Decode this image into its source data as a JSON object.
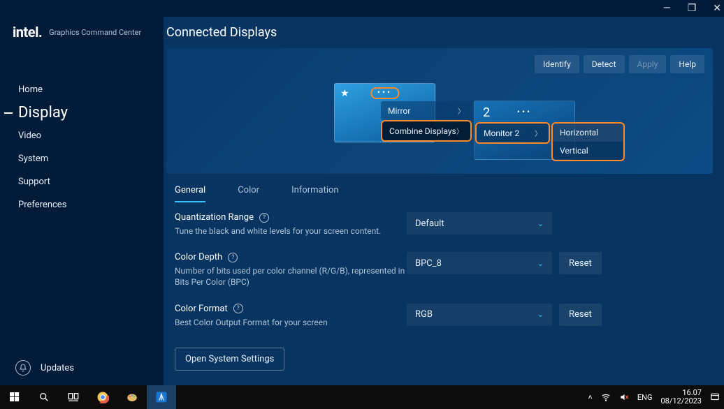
{
  "window": {
    "minimize": "—",
    "restore": "❐",
    "close": "✕"
  },
  "brand": {
    "logo": "intel.",
    "subtitle": "Graphics Command Center"
  },
  "sidebar": {
    "items": [
      {
        "label": "Home"
      },
      {
        "label": "Display"
      },
      {
        "label": "Video"
      },
      {
        "label": "System"
      },
      {
        "label": "Support"
      },
      {
        "label": "Preferences"
      }
    ],
    "updates": "Updates"
  },
  "page": {
    "title": "Connected Displays"
  },
  "actions": {
    "identify": "Identify",
    "detect": "Detect",
    "apply": "Apply",
    "help": "Help"
  },
  "monitors": {
    "mon1_star": "★",
    "mon1_dots": "•••",
    "mon2_num": "2",
    "mon2_dots": "•••"
  },
  "contextMenu": {
    "mirror": "Mirror",
    "combine": "Combine Displays",
    "monitor2": "Monitor 2",
    "horizontal": "Horizontal",
    "vertical": "Vertical"
  },
  "tabs": [
    {
      "label": "General"
    },
    {
      "label": "Color"
    },
    {
      "label": "Information"
    }
  ],
  "settings": {
    "quant": {
      "title": "Quantization Range",
      "desc": "Tune the black and white levels for your screen content.",
      "value": "Default"
    },
    "depth": {
      "title": "Color Depth",
      "desc": "Number of bits used per color channel (R/G/B), represented in Bits Per Color (BPC)",
      "value": "BPC_8",
      "reset": "Reset"
    },
    "format": {
      "title": "Color Format",
      "desc": "Best Color Output Format for your screen",
      "value": "RGB",
      "reset": "Reset"
    }
  },
  "footer": {
    "open_settings": "Open System Settings"
  },
  "taskbar": {
    "lang": "ENG",
    "time": "16.07",
    "date": "08/12/2023"
  }
}
